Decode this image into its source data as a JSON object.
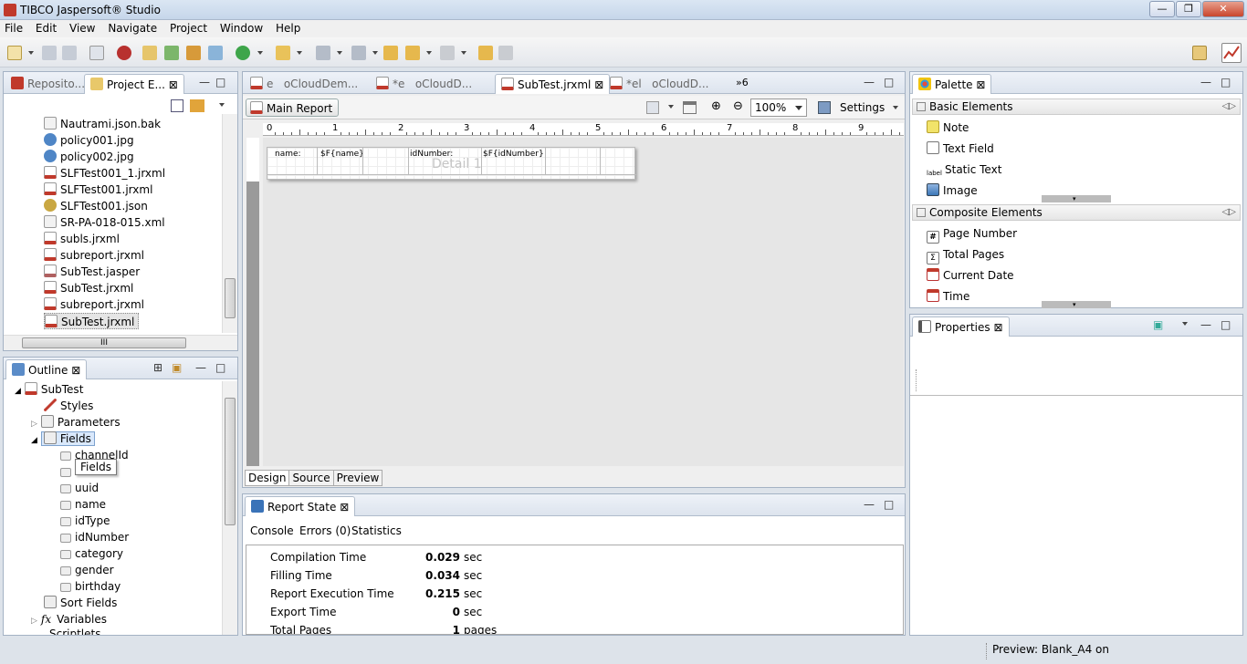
{
  "window": {
    "title": "TIBCO Jaspersoft® Studio",
    "min": "—",
    "restore": "❐",
    "close": "✕"
  },
  "menu": [
    "File",
    "Edit",
    "View",
    "Navigate",
    "Project",
    "Window",
    "Help"
  ],
  "project_panel": {
    "tabs": [
      {
        "label": "Reposito..."
      },
      {
        "label": "Project E..."
      }
    ],
    "files": [
      "Nautrami.json.bak",
      "policy001.jpg",
      "policy002.jpg",
      "SLFTest001_1.jrxml",
      "SLFTest001.jrxml",
      "SLFTest001.json",
      "SR-PA-018-015.xml",
      "subls.jrxml",
      "subreport.jrxml",
      "SubTest.jasper",
      "SubTest.jrxml",
      "subreport.jrxml",
      "SubTest.jrxml"
    ],
    "hscroll_label": "III"
  },
  "outline": {
    "tab": "Outline",
    "root": "SubTest",
    "nodes": {
      "styles": "Styles",
      "parameters": "Parameters",
      "fields": "Fields"
    },
    "fields": [
      "channelId",
      "",
      "uuid",
      "name",
      "idType",
      "idNumber",
      "category",
      "gender",
      "birthday"
    ],
    "tooltip": "Fields",
    "after": [
      "Sort Fields",
      "Variables",
      "Scriptlets"
    ]
  },
  "editor": {
    "tabs": [
      {
        "label": "oCloudDem...",
        "prefix": "e"
      },
      {
        "label": "oCloudD...",
        "prefix": "*e"
      },
      {
        "label": "SubTest.jrxml",
        "prefix": ""
      },
      {
        "label": "oCloudD...",
        "prefix": "*el"
      }
    ],
    "overflow": "»6",
    "main_report": "Main Report",
    "zoom": "100%",
    "settings": "Settings",
    "ruler": [
      "0",
      "1",
      "2",
      "3",
      "4",
      "5",
      "6",
      "7",
      "8",
      "9"
    ],
    "band": {
      "label": "Detail 1",
      "cells": [
        "name:",
        "$F{name}",
        "idNumber:",
        "$F{idNumber}"
      ]
    },
    "bottom_tabs": [
      "Design",
      "Source",
      "Preview"
    ]
  },
  "report_state": {
    "tab": "Report State",
    "subtabs": [
      "Console",
      "Errors (0)",
      "Statistics"
    ],
    "rows": [
      {
        "label": "Compilation Time",
        "value": "0.029",
        "unit": "sec"
      },
      {
        "label": "Filling Time",
        "value": "0.034",
        "unit": "sec"
      },
      {
        "label": "Report Execution Time",
        "value": "0.215",
        "unit": "sec"
      },
      {
        "label": "Export Time",
        "value": "0",
        "unit": "sec"
      },
      {
        "label": "Total Pages",
        "value": "1",
        "unit": "pages"
      }
    ]
  },
  "palette": {
    "tab": "Palette",
    "basic": {
      "title": "Basic Elements",
      "items": [
        "Note",
        "Text Field",
        "Static Text",
        "Image"
      ]
    },
    "composite": {
      "title": "Composite Elements",
      "items": [
        "Page Number",
        "Total Pages",
        "Current Date",
        "Time"
      ]
    }
  },
  "properties": {
    "tab": "Properties"
  },
  "status": {
    "text": "Preview: Blank_A4 on"
  }
}
